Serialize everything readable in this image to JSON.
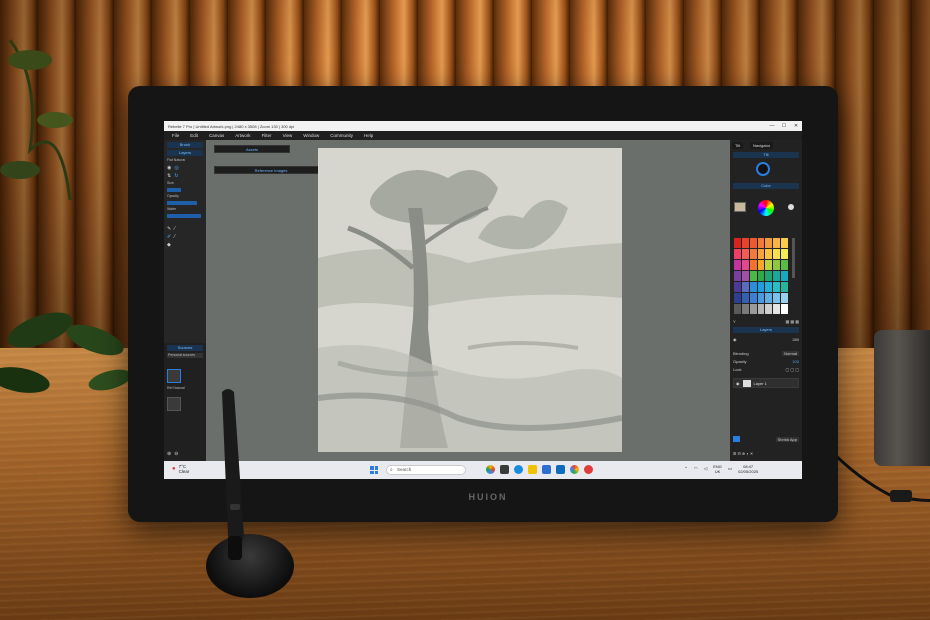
{
  "app": {
    "title": "Rebelle 7 Pro | Untitled Artwork.png | 2480 x 3508 | Zoom 130 | 300 dpi",
    "window_controls": [
      "—",
      "☐",
      "✕"
    ],
    "menu": [
      "File",
      "Edit",
      "Canvas",
      "Artwork",
      "Filter",
      "View",
      "Window",
      "Community",
      "Help"
    ]
  },
  "left_panel": {
    "brush_tab": "Brush",
    "layers_tab": "Layers",
    "preset_label": "Flat Natural",
    "size_label": "Size",
    "opacity_label": "Opacity",
    "water_label": "Water",
    "sources_tab": "Sources",
    "sources_dropdown": "Personal sources",
    "source_thumb_label": "Ref Natural"
  },
  "canvas": {
    "panel_1": "Assets",
    "panel_2": "Reference Images"
  },
  "right_panel": {
    "tab_1": "Tilt",
    "tab_2": "Navigator",
    "tilt_head": "Tilt",
    "color_head": "Color",
    "layers_head": "Layers",
    "zoom_value": "280",
    "blend_label": "Blending",
    "blend_value": "Normal",
    "opacity_label": "Opacity",
    "opacity_value": "100",
    "lock_label": "Lock",
    "layer_name": "Layer 1",
    "bottom_label": "Shrink App"
  },
  "taskbar": {
    "weather_temp": "7°C",
    "weather_desc": "Clear",
    "search_placeholder": "Search",
    "lang": "ENG",
    "lang_sub": "UK",
    "time": "08:47",
    "date": "02/05/2025"
  },
  "device": {
    "brand": "HUION"
  },
  "colors": {
    "accent": "#2a7de1",
    "panel_bg": "#262626",
    "canvas_bg": "#6b6f6c",
    "paper": "#d8d8d0"
  },
  "palette": [
    "#d9231f",
    "#e8432a",
    "#ee5a2f",
    "#f27a34",
    "#f59a3a",
    "#f7b541",
    "#f8ce4a",
    "#ef3e67",
    "#f25c55",
    "#f4793f",
    "#f7a33b",
    "#f9c43f",
    "#fae04b",
    "#f2ee53",
    "#c7329e",
    "#e34790",
    "#f0742c",
    "#f6a723",
    "#bcd33a",
    "#8ec63f",
    "#5cba47",
    "#7b3fa0",
    "#a24fa8",
    "#4cb848",
    "#2ea84b",
    "#1fa371",
    "#1aa89a",
    "#17a9bf",
    "#4b3a9a",
    "#5a6bc0",
    "#2a8fd7",
    "#1b9fe0",
    "#1fb2d8",
    "#25bfc7",
    "#28b49a",
    "#2d3f8f",
    "#355fb0",
    "#3f7ed0",
    "#4a9adf",
    "#62aee4",
    "#7cc1e8",
    "#9ad2ec",
    "#5a5a5a",
    "#7a7a7a",
    "#9a9a9a",
    "#b5b5b5",
    "#cfcfcf",
    "#e5e5e5",
    "#ffffff"
  ]
}
